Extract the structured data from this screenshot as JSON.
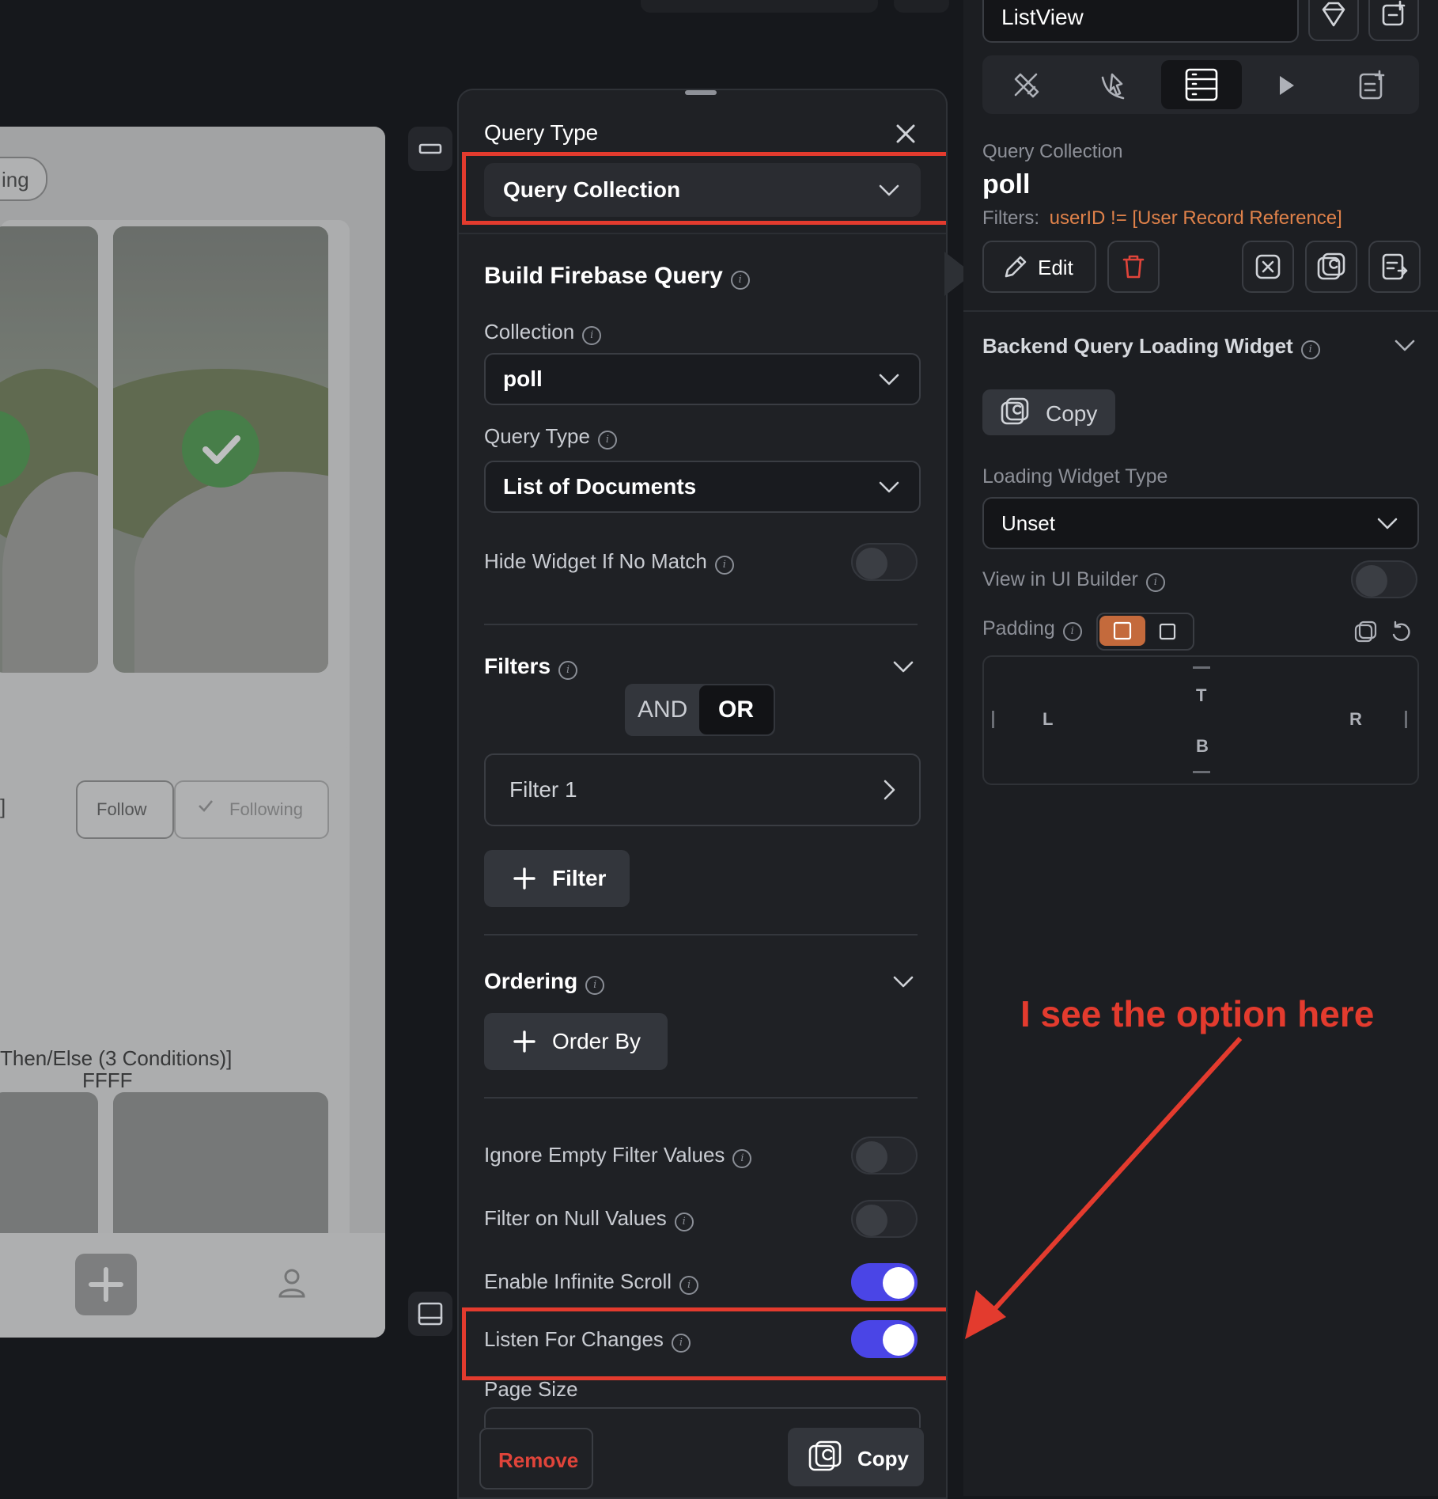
{
  "preview": {
    "chip_text": "ing",
    "follow_label": "Follow",
    "following_label": "Following",
    "bracket_text": "]",
    "conditions_text": "Then/Else (3 Conditions)]",
    "color_code": "FFFF"
  },
  "query_panel": {
    "title": "Query Type",
    "query_type_selected": "Query Collection",
    "build_title": "Build Firebase Query",
    "collection_label": "Collection",
    "collection_value": "poll",
    "query_type_label": "Query Type",
    "query_type_value": "List of Documents",
    "hide_widget_label": "Hide Widget If No Match",
    "filters_label": "Filters",
    "and_label": "AND",
    "or_label": "OR",
    "filter_item": "Filter 1",
    "add_filter_label": "Filter",
    "ordering_label": "Ordering",
    "order_by_label": "Order By",
    "ignore_empty_label": "Ignore Empty Filter Values",
    "filter_null_label": "Filter on Null Values",
    "infinite_scroll_label": "Enable Infinite Scroll",
    "listen_changes_label": "Listen For Changes",
    "page_size_label": "Page Size",
    "remove_label": "Remove",
    "copy_label": "Copy",
    "toggles": {
      "hide_widget": false,
      "ignore_empty": false,
      "filter_null": false,
      "infinite_scroll": true,
      "listen_changes": true
    }
  },
  "right_panel": {
    "widget_name": "ListView",
    "query_kind": "Query Collection",
    "collection": "poll",
    "filters_prefix": "Filters:",
    "filters_value": "userID != [User Record Reference]",
    "edit_label": "Edit",
    "loading_widget_title": "Backend Query Loading Widget",
    "copy_label": "Copy",
    "loading_type_label": "Loading Widget Type",
    "loading_type_value": "Unset",
    "view_ui_builder_label": "View in UI Builder",
    "padding_label": "Padding",
    "pad_t": "T",
    "pad_l": "L",
    "pad_r": "R",
    "pad_b": "B"
  },
  "annotation": {
    "text": "I see the option here",
    "color": "#e33b2e"
  },
  "colors": {
    "toggle_on": "#4a45e6",
    "accent_orange": "#e0824a",
    "danger": "#e0443a"
  }
}
